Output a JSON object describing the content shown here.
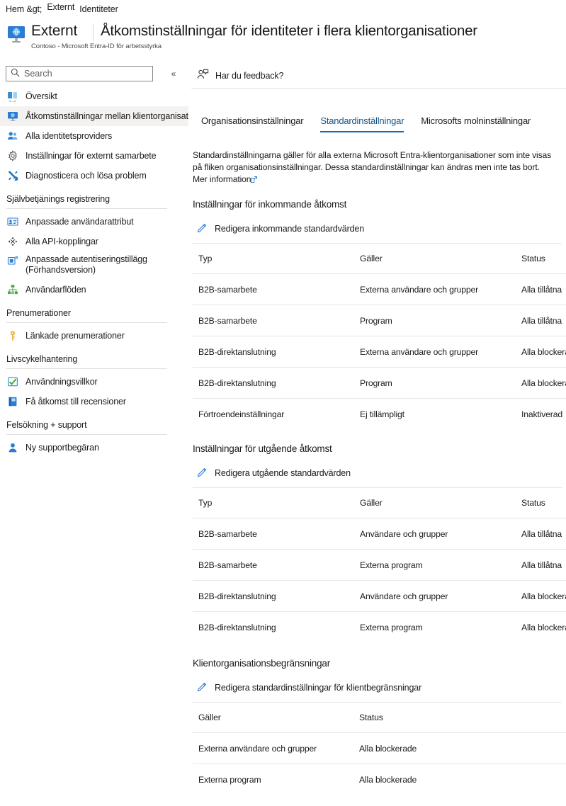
{
  "breadcrumb": {
    "items": [
      "Hem &gt;",
      "Externt",
      "Identiteter"
    ]
  },
  "header": {
    "icon": "external-identities-monitor-icon",
    "resource_title": "Externt",
    "resource_subtitle": "Contoso - Microsoft Entra-ID för arbetsstyrka",
    "blade_title": "Åtkomstinställningar för identiteter i flera klientorganisationer"
  },
  "sidebar": {
    "search": {
      "placeholder": "Search",
      "value": "",
      "icon": "search-icon"
    },
    "collapse": {
      "icon": "chevron-double-left-icon"
    },
    "items": [
      {
        "label": "Översikt",
        "icon": "overview-icon",
        "selected": false
      },
      {
        "label": "Åtkomstinställningar mellan klientorganisationer",
        "icon": "cross-tenant-monitor-icon",
        "selected": true
      },
      {
        "label": "Alla identitetsproviders",
        "icon": "identity-providers-icon",
        "selected": false
      },
      {
        "label": "Inställningar för externt samarbete",
        "icon": "gear-icon",
        "selected": false
      },
      {
        "label": "Diagnosticera och lösa problem",
        "icon": "troubleshoot-tools-icon",
        "selected": false
      }
    ],
    "groups": [
      {
        "title": "Självbetjänings registrering",
        "items": [
          {
            "label": "Anpassade användarattribut",
            "icon": "user-attributes-icon"
          },
          {
            "label": "Alla API-kopplingar",
            "icon": "api-connectors-icon"
          },
          {
            "label": "Anpassade autentiseringstillägg (Förhandsversion)",
            "icon": "custom-authentication-extensions-icon"
          },
          {
            "label": "Användarflöden",
            "icon": "user-flows-icon"
          }
        ]
      },
      {
        "title": "Prenumerationer",
        "items": [
          {
            "label": "Länkade prenumerationer",
            "icon": "key-icon"
          }
        ]
      },
      {
        "title": "Livscykelhantering",
        "items": [
          {
            "label": "Användningsvillkor",
            "icon": "terms-of-use-check-icon"
          },
          {
            "label": "Få åtkomst till recensioner",
            "icon": "access-reviews-book-icon"
          }
        ]
      },
      {
        "title": "Felsökning + support",
        "items": [
          {
            "label": "Ny supportbegäran",
            "icon": "support-person-icon"
          }
        ]
      }
    ]
  },
  "main": {
    "feedback": {
      "label": "Har du feedback?",
      "icon": "feedback-person-icon"
    },
    "tabs": [
      {
        "label": "Organisationsinställningar",
        "active": false
      },
      {
        "label": "Standardinställningar",
        "active": true
      },
      {
        "label": "Microsofts molninställningar",
        "active": false
      }
    ],
    "description": "Standardinställningarna gäller för alla externa Microsoft Entra-klientorganisationer som inte visas på fliken organisationsinställningar. Dessa standardinställningar kan ändras men inte tas bort.",
    "more_info_link": "Mer information",
    "sections": [
      {
        "title": "Inställningar för inkommande åtkomst",
        "edit_label": "Redigera inkommande standardvärden",
        "edit_icon": "pencil-edit-icon",
        "columns": [
          "Typ",
          "Gäller",
          "Status"
        ],
        "rows": [
          {
            "typ": "B2B-samarbete",
            "galler": "Externa användare och grupper",
            "status": "Alla tillåtna",
            "status_small": false
          },
          {
            "typ": "B2B-samarbete",
            "galler": "Program",
            "status": "Alla tillåtna",
            "status_small": false
          },
          {
            "typ": "B2B-direktanslutning",
            "galler": "Externa användare och grupper",
            "status": "Alla blockerade",
            "status_small": true
          },
          {
            "typ": "B2B-direktanslutning",
            "galler": "Program",
            "status": "Alla blockerade",
            "status_small": true
          },
          {
            "typ": "Förtroendeinställningar",
            "galler": "Ej tillämpligt",
            "galler_small": true,
            "status": "Inaktiverad",
            "status_small": false
          }
        ]
      },
      {
        "title": "Inställningar för utgående åtkomst",
        "edit_label": "Redigera utgående standardvärden",
        "edit_icon": "pencil-edit-icon",
        "columns": [
          "Typ",
          "Gäller",
          "Status"
        ],
        "rows": [
          {
            "typ": "B2B-samarbete",
            "galler": "Användare och grupper",
            "status": "Alla tillåtna",
            "status_small": false
          },
          {
            "typ": "B2B-samarbete",
            "galler": "Externa program",
            "status": "Alla tillåtna",
            "status_small": false
          },
          {
            "typ": "B2B-direktanslutning",
            "galler": "Användare och grupper",
            "status": "Alla blockerade",
            "status_small": true
          },
          {
            "typ": "B2B-direktanslutning",
            "galler": "Externa program",
            "status": "Alla blockerade",
            "status_small": true
          }
        ]
      },
      {
        "title": "Klientorganisationsbegränsningar",
        "edit_label": "Redigera standardinställningar för klientbegränsningar",
        "edit_icon": "pencil-edit-icon",
        "columns": [
          "Gäller",
          "Status"
        ],
        "rows": [
          {
            "galler": "Externa användare och grupper",
            "status": "Alla blockerade"
          },
          {
            "galler": "Externa program",
            "status": "Alla blockerade"
          }
        ]
      }
    ]
  }
}
